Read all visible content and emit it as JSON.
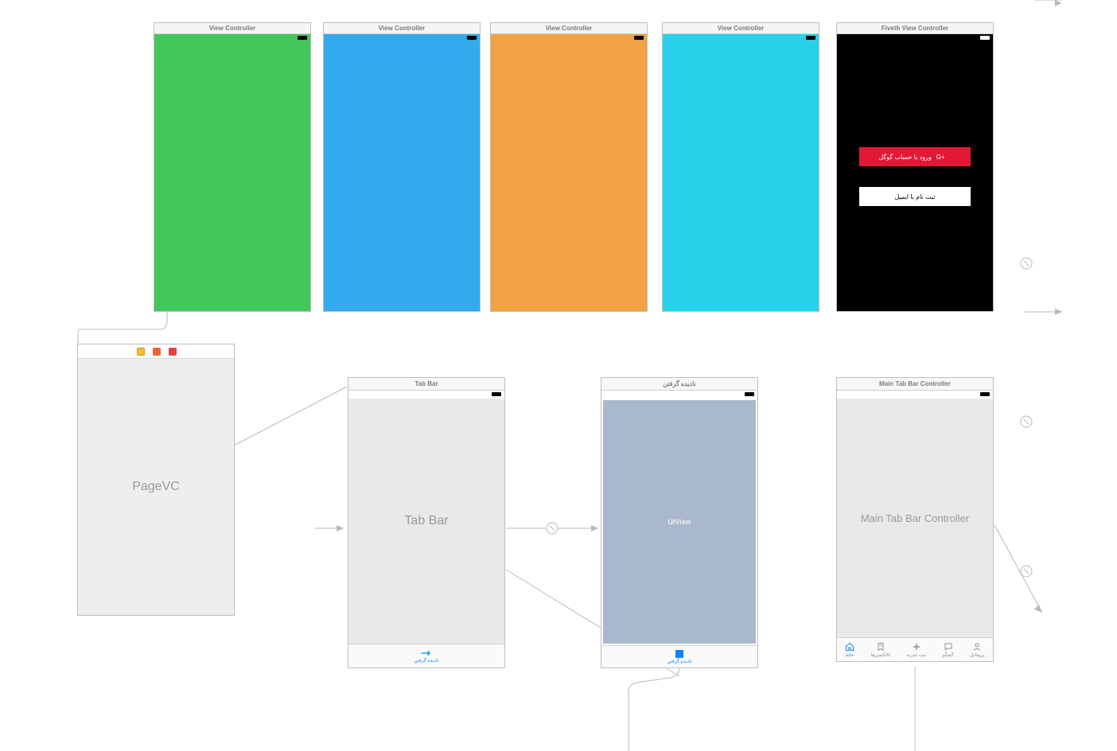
{
  "top_row": {
    "scenes": [
      {
        "title": "View Controller",
        "color": "#42c85a"
      },
      {
        "title": "View Controller",
        "color": "#34aaee"
      },
      {
        "title": "View Controller",
        "color": "#f2a143"
      },
      {
        "title": "View Controller",
        "color": "#27d1ea"
      }
    ],
    "login_scene": {
      "title": "Fiveth View Controller",
      "google_button": "ورود با حساب گوگل",
      "google_icon_label": "G+",
      "email_button": "ثبت نام با ایمیل"
    }
  },
  "bottom_row": {
    "pagevc": {
      "body_label": "PageVC"
    },
    "tabbar": {
      "title": "Tab Bar",
      "body_label": "Tab Bar",
      "footer_label": "نادیده گرفتن"
    },
    "ignore": {
      "title": "نادیده گرفتن",
      "body_label": "UIView",
      "footer_label": "نادیده گرفتن"
    },
    "maintab": {
      "title": "Main Tab Bar Controller",
      "body_label": "Main Tab Bar Controller",
      "tabs": [
        {
          "label": "خانه",
          "active": true
        },
        {
          "label": "کالکشن‌ها",
          "active": false
        },
        {
          "label": "ثبت تجربه",
          "active": false
        },
        {
          "label": "گفتگو",
          "active": false
        },
        {
          "label": "پروفایل",
          "active": false
        }
      ]
    }
  }
}
